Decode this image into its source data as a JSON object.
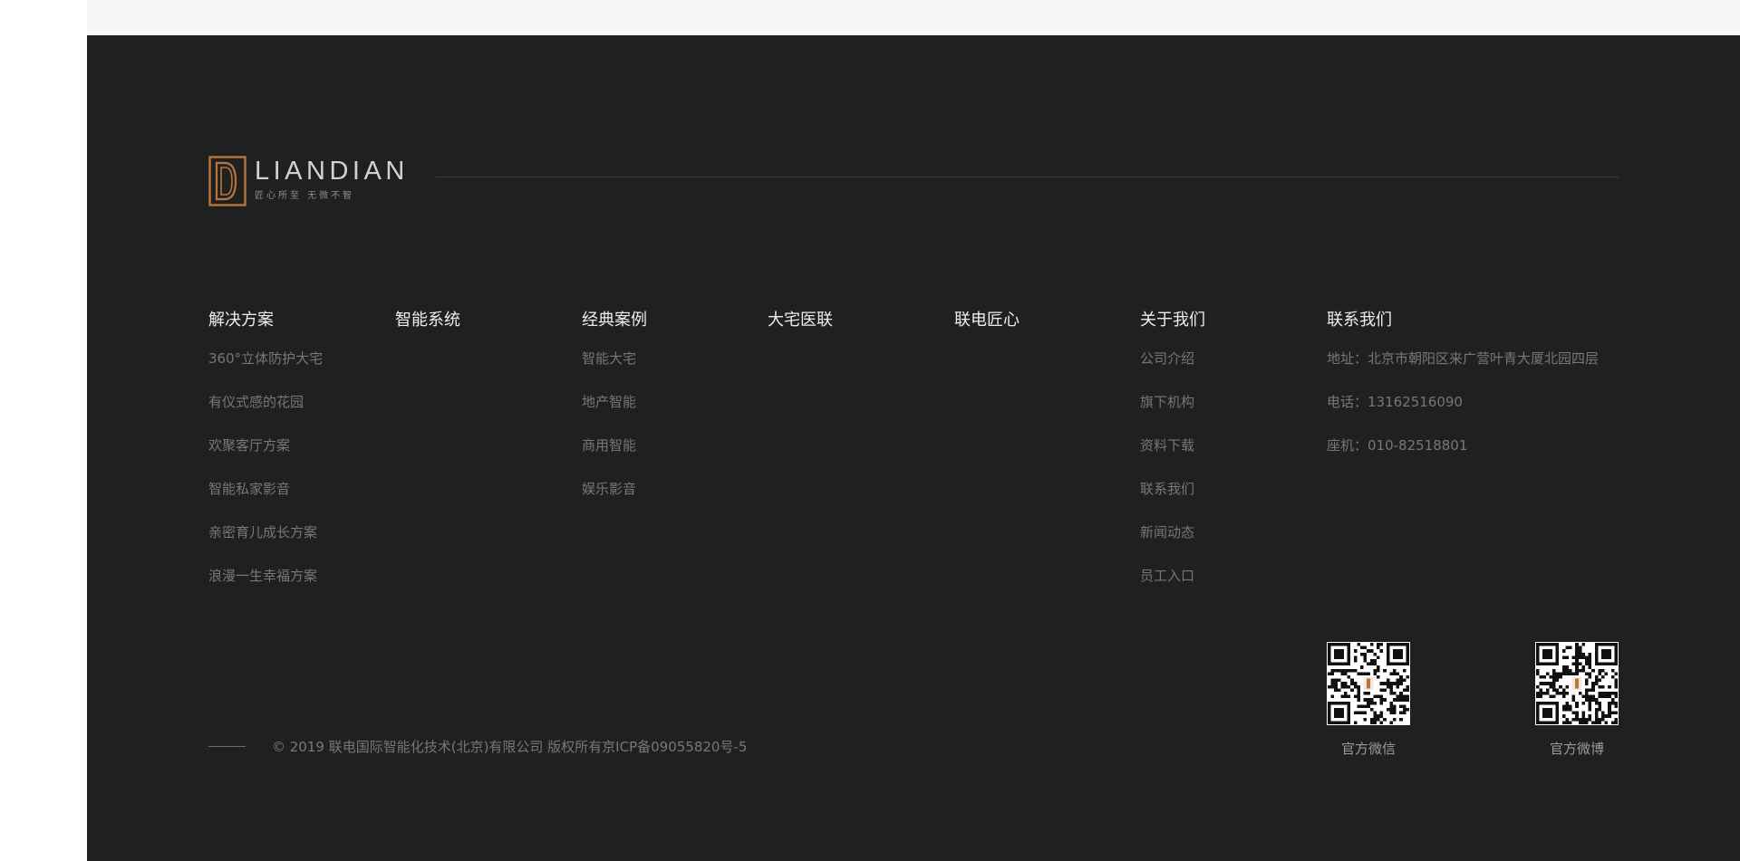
{
  "brand": {
    "wordmark": "LIANDIAN",
    "tagline": "匠心所至  无微不智",
    "accent_color": "#b7773c"
  },
  "footer": {
    "background": "#202020",
    "columns": [
      {
        "title": "解决方案",
        "items": [
          "360°立体防护大宅",
          "有仪式感的花园",
          "欢聚客厅方案",
          "智能私家影音",
          "亲密育儿成长方案",
          "浪漫一生幸福方案"
        ]
      },
      {
        "title": "智能系统",
        "items": []
      },
      {
        "title": "经典案例",
        "items": [
          "智能大宅",
          "地产智能",
          "商用智能",
          "娱乐影音"
        ]
      },
      {
        "title": "大宅医联",
        "items": []
      },
      {
        "title": "联电匠心",
        "items": []
      },
      {
        "title": "关于我们",
        "items": [
          "公司介绍",
          "旗下机构",
          "资料下载",
          "联系我们",
          "新闻动态",
          "员工入口"
        ]
      },
      {
        "title": "联系我们",
        "items": [
          "地址：北京市朝阳区来广营叶青大厦北园四层",
          "电话：13162516090",
          "座机：010-82518801"
        ]
      }
    ],
    "qr_codes": [
      {
        "label": "官方微信",
        "icon": "qr-code-icon"
      },
      {
        "label": "官方微博",
        "icon": "qr-code-icon"
      }
    ],
    "copyright": "© 2019 联电国际智能化技术(北京)有限公司 版权所有京ICP备09055820号-5"
  }
}
